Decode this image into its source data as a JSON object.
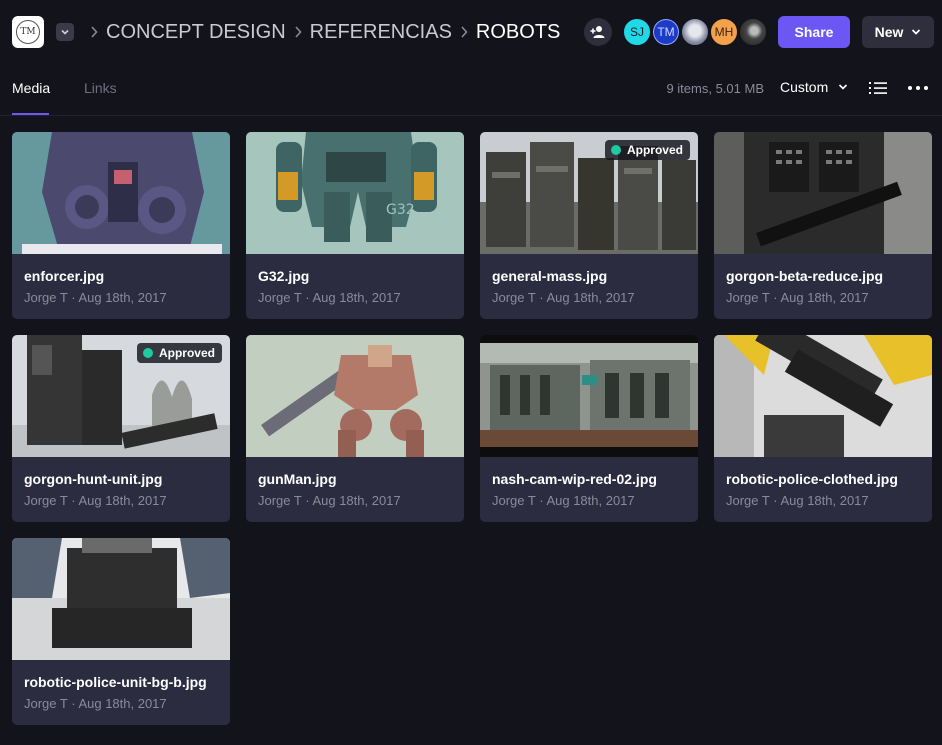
{
  "header": {
    "logo_text": "TM",
    "breadcrumb": [
      {
        "label": "CONCEPT DESIGN"
      },
      {
        "label": "REFERENCIAS"
      },
      {
        "label": "ROBOTS"
      }
    ],
    "avatars": [
      {
        "initials": "SJ"
      },
      {
        "initials": "TM"
      },
      {
        "initials": ""
      },
      {
        "initials": "MH"
      },
      {
        "initials": ""
      }
    ],
    "share_label": "Share",
    "new_label": "New"
  },
  "toolbar": {
    "tabs": [
      {
        "label": "Media",
        "active": true
      },
      {
        "label": "Links",
        "active": false
      }
    ],
    "summary": "9 items, 5.01 MB",
    "sort_label": "Custom"
  },
  "colors": {
    "accent": "#6c57f5",
    "approved": "#1fc9a2",
    "background": "#13131c",
    "card": "#2c2c40"
  },
  "items": [
    {
      "name": "enforcer.jpg",
      "author": "Jorge T",
      "date": "Aug 18th, 2017",
      "status": ""
    },
    {
      "name": "G32.jpg",
      "author": "Jorge T",
      "date": "Aug 18th, 2017",
      "status": ""
    },
    {
      "name": "general-mass.jpg",
      "author": "Jorge T",
      "date": "Aug 18th, 2017",
      "status": "Approved"
    },
    {
      "name": "gorgon-beta-reduce.jpg",
      "author": "Jorge T",
      "date": "Aug 18th, 2017",
      "status": ""
    },
    {
      "name": "gorgon-hunt-unit.jpg",
      "author": "Jorge T",
      "date": "Aug 18th, 2017",
      "status": "Approved"
    },
    {
      "name": "gunMan.jpg",
      "author": "Jorge T",
      "date": "Aug 18th, 2017",
      "status": ""
    },
    {
      "name": "nash-cam-wip-red-02.jpg",
      "author": "Jorge T",
      "date": "Aug 18th, 2017",
      "status": ""
    },
    {
      "name": "robotic-police-clothed.jpg",
      "author": "Jorge T",
      "date": "Aug 18th, 2017",
      "status": ""
    },
    {
      "name": "robotic-police-unit-bg-b.jpg",
      "author": "Jorge T",
      "date": "Aug 18th, 2017",
      "status": ""
    }
  ]
}
